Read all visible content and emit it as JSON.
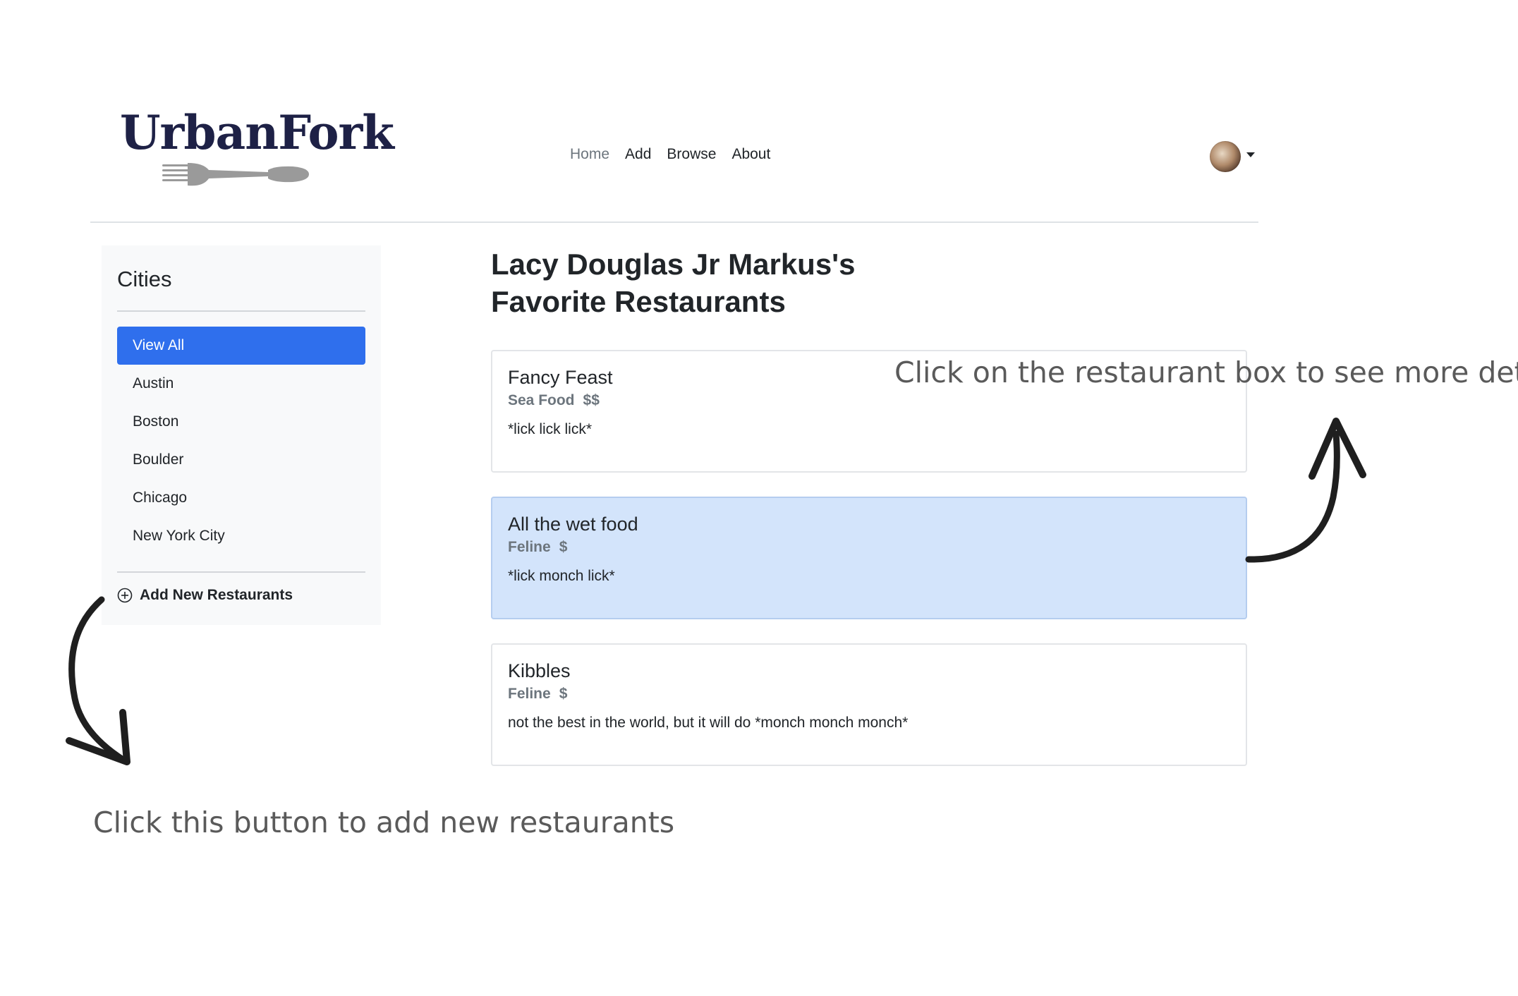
{
  "brand": {
    "logo_text": "UrbanFork"
  },
  "nav": {
    "items": [
      {
        "label": "Home"
      },
      {
        "label": "Add"
      },
      {
        "label": "Browse"
      },
      {
        "label": "About"
      }
    ]
  },
  "sidebar": {
    "title": "Cities",
    "cities": [
      {
        "label": "View All"
      },
      {
        "label": "Austin"
      },
      {
        "label": "Boston"
      },
      {
        "label": "Boulder"
      },
      {
        "label": "Chicago"
      },
      {
        "label": "New York City"
      }
    ],
    "add_label": "Add New Restaurants"
  },
  "main": {
    "title_line1": "Lacy Douglas Jr Markus's",
    "title_line2": "Favorite Restaurants",
    "restaurants": [
      {
        "name": "Fancy Feast",
        "cuisine": "Sea Food",
        "price": "$$",
        "description": "*lick lick lick*"
      },
      {
        "name": "All the wet food",
        "cuisine": "Feline",
        "price": "$",
        "description": "*lick monch lick*"
      },
      {
        "name": "Kibbles",
        "cuisine": "Feline",
        "price": "$",
        "description": "not the best in the world, but it will do *monch monch monch*"
      }
    ]
  },
  "annotations": {
    "details_hint": "Click on the restaurant box to see more details",
    "add_hint": "Click this button to add new restaurants"
  },
  "colors": {
    "brand": "#1e2146",
    "active": "#2f6fed",
    "highlight": "#d3e4fb",
    "muted": "#6c757d"
  }
}
